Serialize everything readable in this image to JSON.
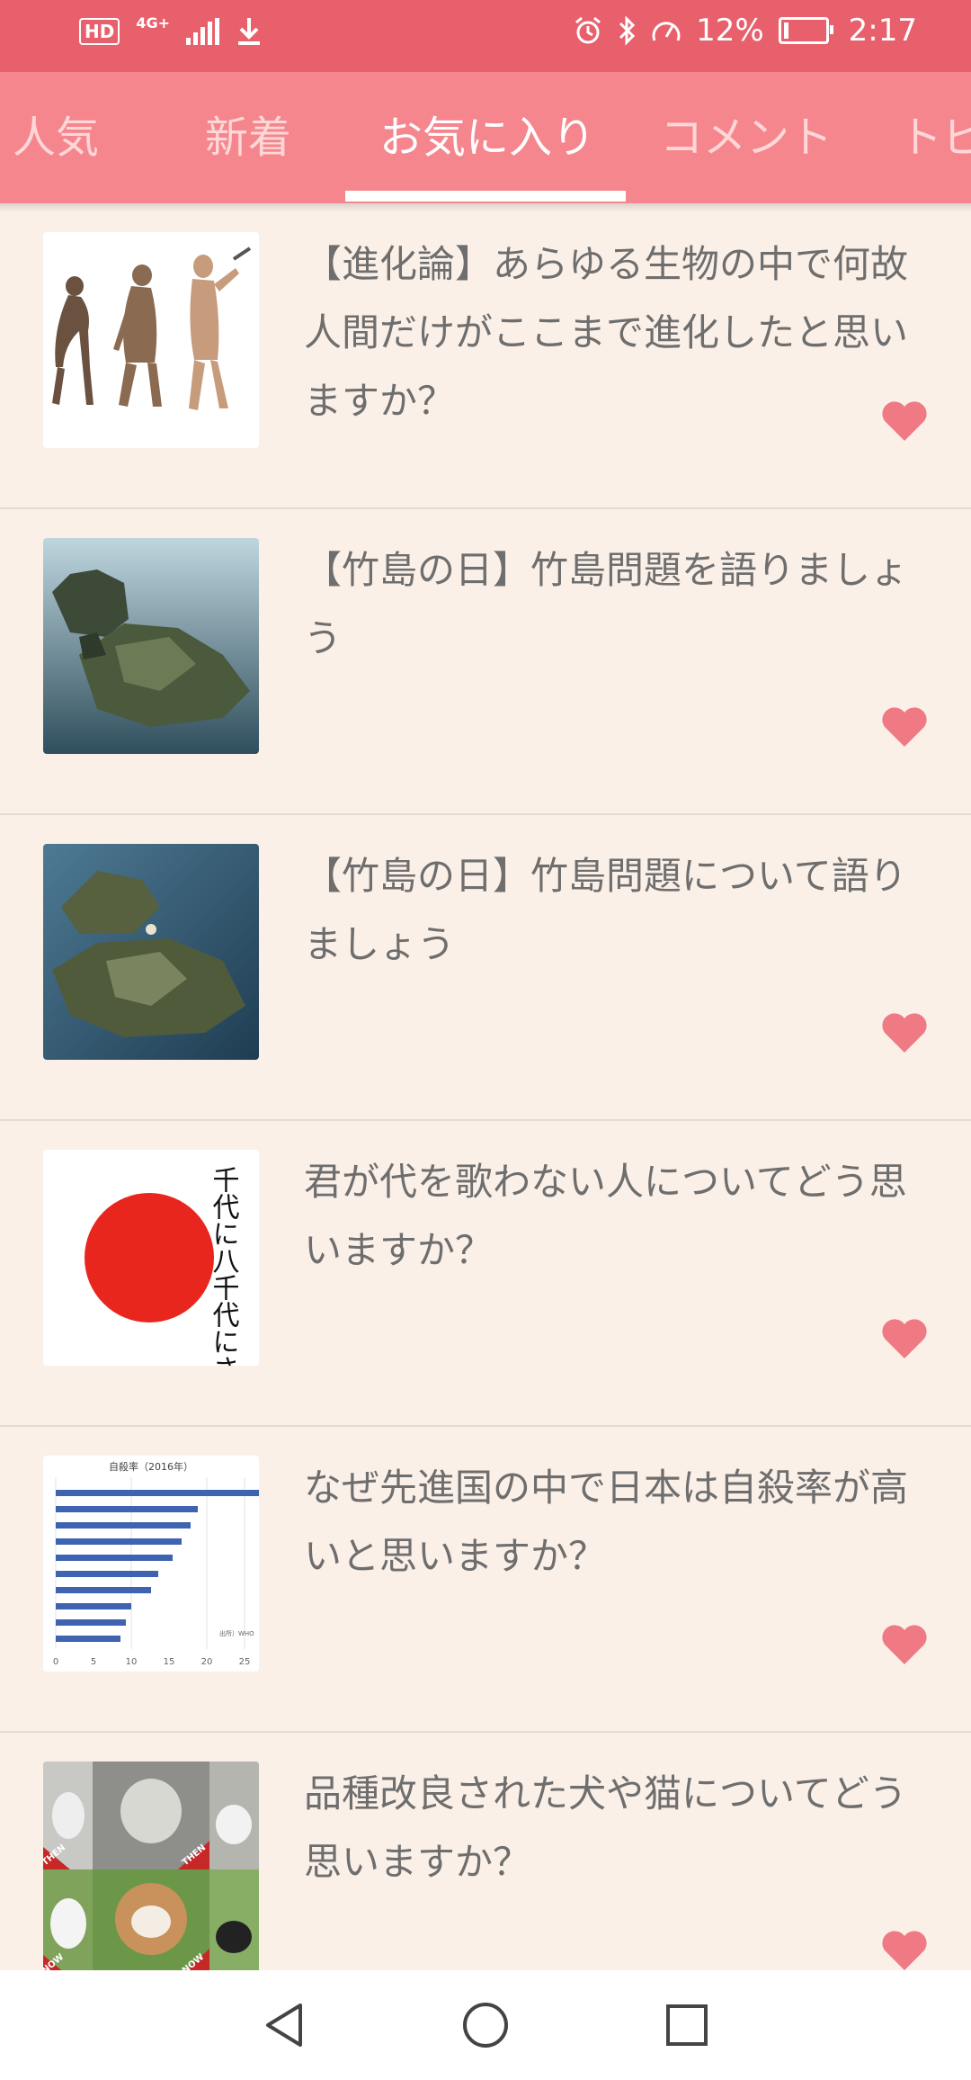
{
  "status_bar": {
    "hd_label": "HD",
    "network": "4G+",
    "battery_percent": "12%",
    "battery_level": 0.12,
    "time": "2:17"
  },
  "tabs": [
    {
      "label": "人気",
      "active": false
    },
    {
      "label": "新着",
      "active": false
    },
    {
      "label": "お気に入り",
      "active": true
    },
    {
      "label": "コメント",
      "active": false
    },
    {
      "label": "トピ",
      "active": false
    }
  ],
  "items": [
    {
      "title": "【進化論】あらゆる生物の中で何故人間だけがここまで進化したと思いますか？",
      "thumb": "evolution"
    },
    {
      "title": "【竹島の日】竹島問題を語りましょう",
      "thumb": "island"
    },
    {
      "title": "【竹島の日】竹島問題について語りましょう",
      "thumb": "island"
    },
    {
      "title": "君が代を歌わない人についてどう思いますか？",
      "thumb": "flag",
      "thumb_text": "千代に八千代にさざれ石の巌となりて"
    },
    {
      "title": "なぜ先進国の中で日本は自殺率が高いと思いますか？",
      "thumb": "chart",
      "thumb_text": "自殺率（2016年）",
      "thumb_ticks": [
        "0",
        "5",
        "10",
        "15",
        "20",
        "25"
      ],
      "thumb_note": "出所）WHO"
    },
    {
      "title": "品種改良された犬や猫についてどう思いますか？",
      "thumb": "dogs",
      "thumb_labels": [
        "THEN",
        "THEN",
        "NOW",
        "NOW"
      ]
    }
  ],
  "colors": {
    "status_bar": "#E8606C",
    "tab_bar": "#F5868E",
    "heart": "#F07A83",
    "background": "#FBF0E8"
  },
  "icons": {
    "favorite": "heart-icon",
    "back": "back-triangle-icon",
    "home": "home-circle-icon",
    "recents": "recents-square-icon"
  }
}
